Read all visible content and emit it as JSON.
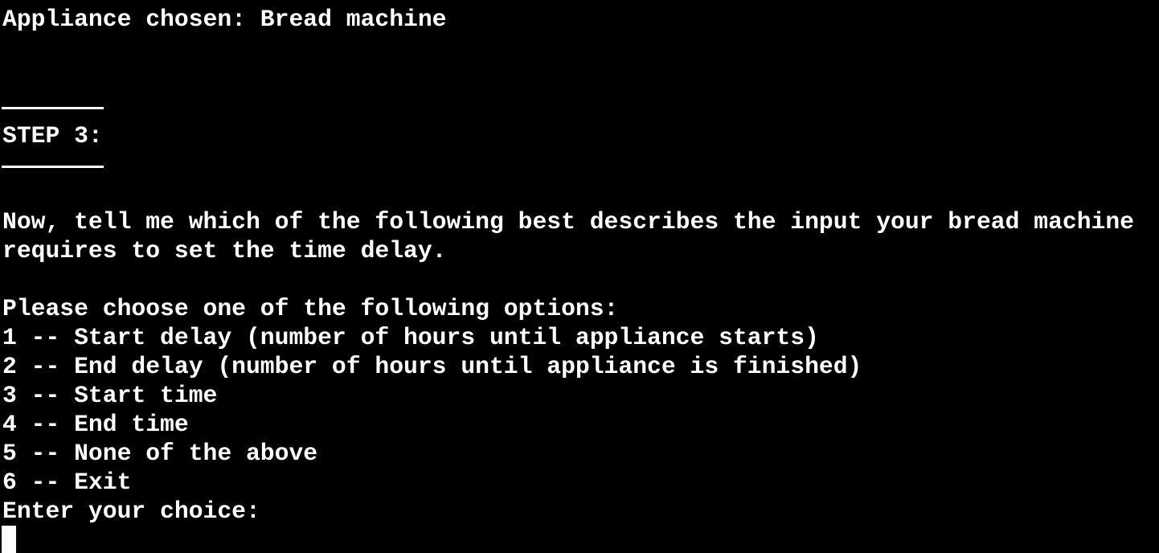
{
  "terminal": {
    "appliance_line": "Appliance chosen: Bread machine",
    "step_title": "STEP 3:",
    "prompt_line_1": "Now, tell me which of the following best describes the input your bread machine",
    "prompt_line_2": "requires to set the time delay.",
    "options_header": "Please choose one of the following options:",
    "options": [
      "1 -- Start delay (number of hours until appliance starts)",
      "2 -- End delay (number of hours until appliance is finished)",
      "3 -- Start time",
      "4 -- End time",
      "5 -- None of the above",
      "6 -- Exit"
    ],
    "input_prompt": "Enter your choice:"
  },
  "colors": {
    "background": "#000000",
    "foreground": "#ffffff"
  }
}
